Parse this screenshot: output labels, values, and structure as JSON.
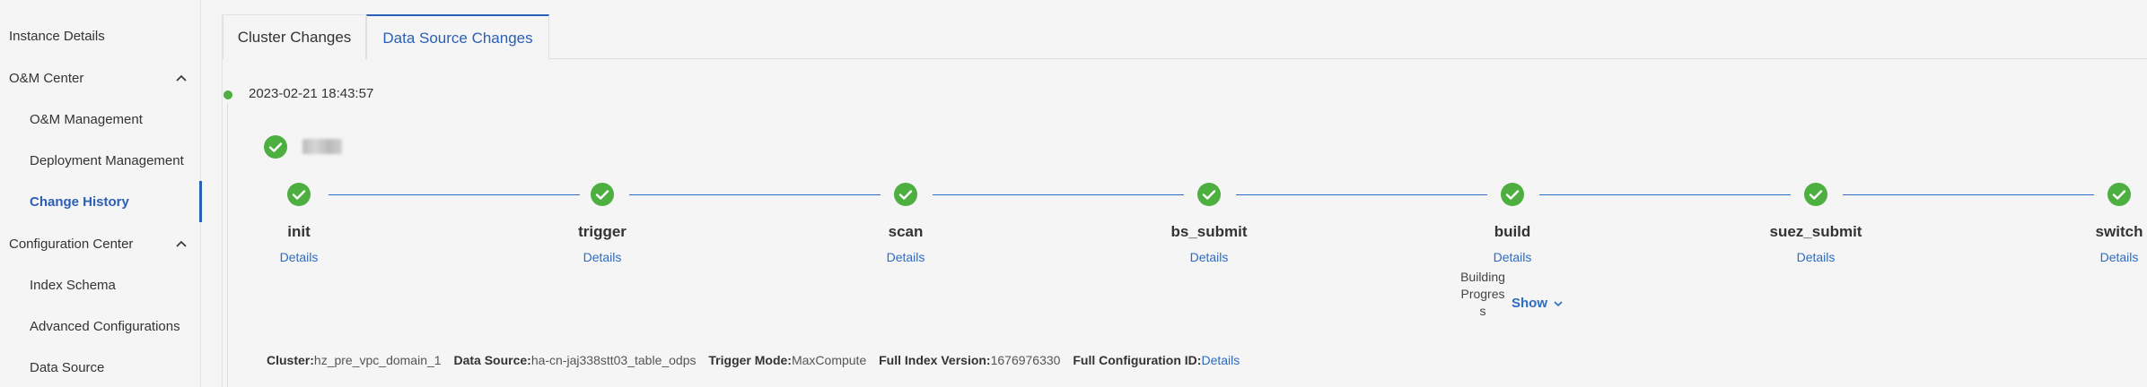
{
  "sidebar": {
    "items": [
      {
        "label": "Instance Details"
      },
      {
        "label": "O&M Center"
      },
      {
        "label": "O&M Management"
      },
      {
        "label": "Deployment Management"
      },
      {
        "label": "Change History"
      },
      {
        "label": "Configuration Center"
      },
      {
        "label": "Index Schema"
      },
      {
        "label": "Advanced Configurations"
      },
      {
        "label": "Data Source"
      }
    ]
  },
  "tabs": [
    {
      "label": "Cluster Changes"
    },
    {
      "label": "Data Source Changes"
    }
  ],
  "timeline": {
    "timestamp": "2023-02-21 18:43:57",
    "stages": [
      {
        "name": "init",
        "details": "Details"
      },
      {
        "name": "trigger",
        "details": "Details"
      },
      {
        "name": "scan",
        "details": "Details"
      },
      {
        "name": "bs_submit",
        "details": "Details"
      },
      {
        "name": "build",
        "details": "Details"
      },
      {
        "name": "suez_submit",
        "details": "Details"
      },
      {
        "name": "switch",
        "details": "Details"
      }
    ],
    "building_progress_label": "Building Progress",
    "show_label": "Show"
  },
  "meta": {
    "cluster_key": "Cluster:",
    "cluster_val": "hz_pre_vpc_domain_1",
    "ds_key": "Data Source:",
    "ds_val": "ha-cn-jaj338stt03_table_odps",
    "trigger_key": "Trigger Mode:",
    "trigger_val": "MaxCompute",
    "fiv_key": "Full Index Version:",
    "fiv_val": "1676976330",
    "fcid_key": "Full Configuration ID:",
    "fcid_link": "Details"
  },
  "colors": {
    "accent": "#2b6cc4",
    "success": "#4caf3f"
  }
}
